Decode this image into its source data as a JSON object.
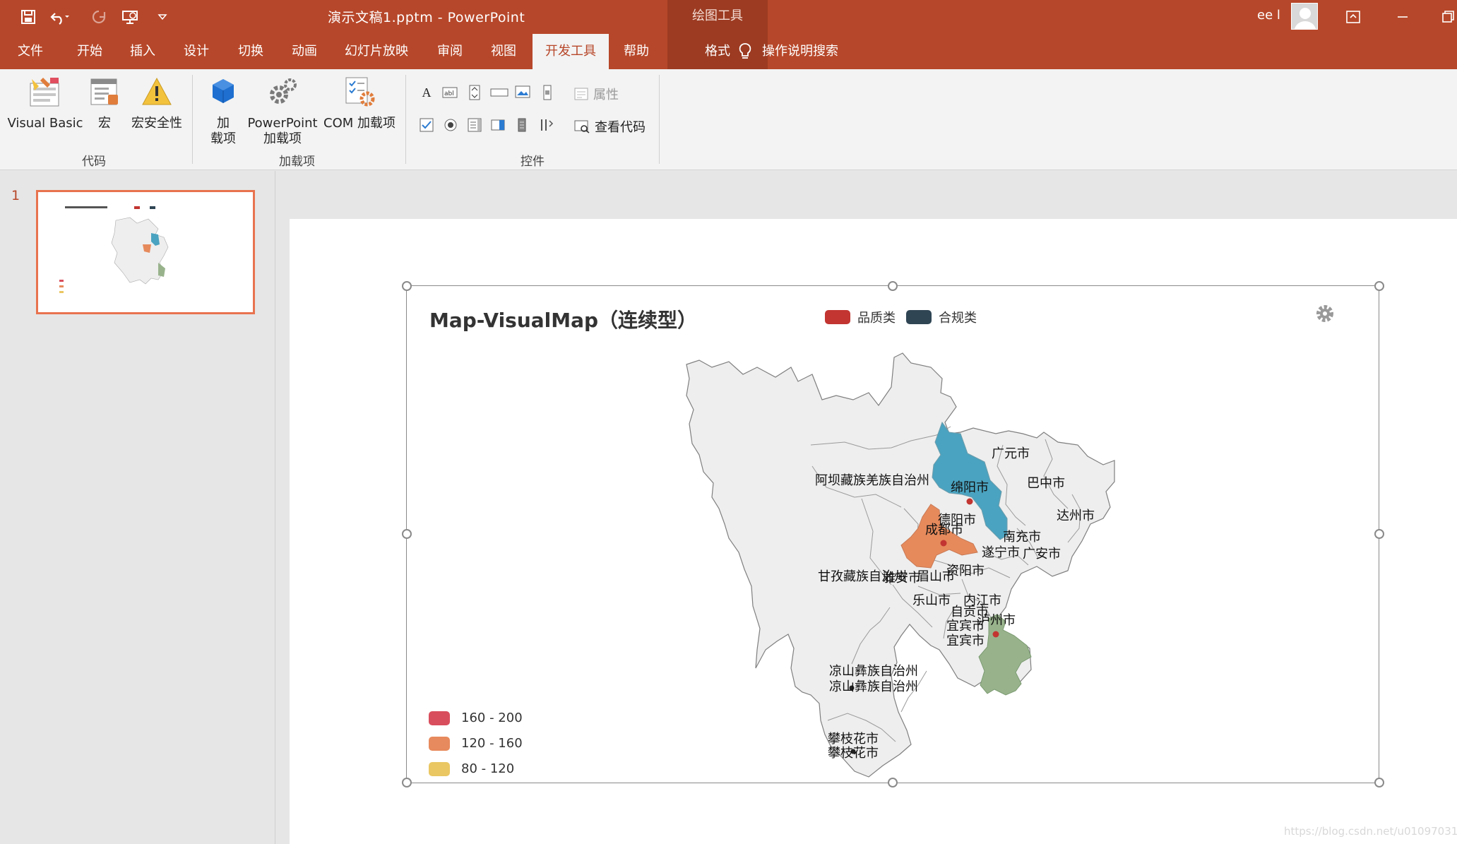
{
  "window": {
    "doc_title": "演示文稿1.pptm  -  PowerPoint",
    "context_tools": "绘图工具",
    "user": "ee l"
  },
  "tabs": [
    {
      "label": "文件"
    },
    {
      "label": "开始"
    },
    {
      "label": "插入"
    },
    {
      "label": "设计"
    },
    {
      "label": "切换"
    },
    {
      "label": "动画"
    },
    {
      "label": "幻灯片放映"
    },
    {
      "label": "审阅"
    },
    {
      "label": "视图"
    },
    {
      "label": "开发工具"
    },
    {
      "label": "帮助"
    },
    {
      "label": "格式"
    }
  ],
  "tell_me": "操作说明搜索",
  "ribbon": {
    "code_group": {
      "label": "代码",
      "visual_basic": "Visual Basic",
      "macros": "宏",
      "macro_security": "宏安全性"
    },
    "addins_group": {
      "label": "加载项",
      "addins_l1": "加",
      "addins_l2": "载项",
      "ppt_addins_l1": "PowerPoint",
      "ppt_addins_l2": "加载项",
      "com_addins": "COM 加载项"
    },
    "controls_group": {
      "label": "控件",
      "properties": "属性",
      "view_code": "查看代码"
    }
  },
  "slides_pane": {
    "slide_number": "1"
  },
  "chart_data": {
    "type": "map",
    "title": "Map-VisualMap（连续型）",
    "legend": [
      {
        "name": "品质类",
        "color": "#c23531"
      },
      {
        "name": "合规类",
        "color": "#2f4554"
      }
    ],
    "visual_map": [
      {
        "range": "160 - 200",
        "color": "#d94e5d"
      },
      {
        "range": "120 - 160",
        "color": "#e78a5d"
      },
      {
        "range": "80 - 120",
        "color": "#eac763"
      }
    ],
    "highlighted_regions": [
      {
        "name": "绵阳市",
        "color": "#4aa3c0"
      },
      {
        "name": "成都市",
        "color": "#e68a5c"
      },
      {
        "name": "泸州市",
        "color": "#98b38c"
      }
    ],
    "region_labels": [
      "广元市",
      "巴中市",
      "阿坝藏族羌族自治州",
      "绵阳市",
      "达州市",
      "德阳市",
      "成都市",
      "南充市",
      "遂宁市",
      "广安市",
      "资阳市",
      "甘孜藏族自治州",
      "雅安市",
      "眉山市",
      "内江市",
      "乐山市",
      "自贡市",
      "泸州市",
      "宜宾市",
      "宜宾市",
      "凉山彝族自治州",
      "凉山彝族自治州",
      "攀枝花市",
      "攀枝花市"
    ]
  },
  "watermark": "https://blog.csdn.net/u010970317"
}
